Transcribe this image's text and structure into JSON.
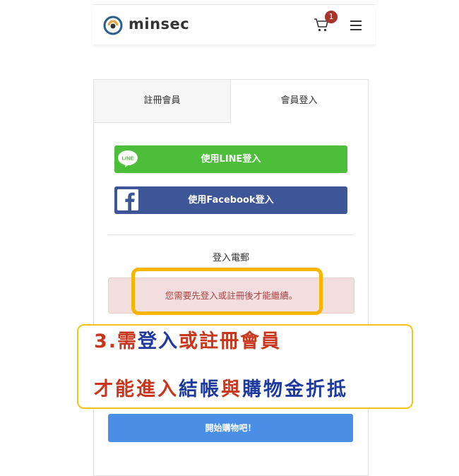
{
  "header": {
    "brand": "minsec",
    "cart_count": "1"
  },
  "tabs": [
    {
      "label": "註冊會員"
    },
    {
      "label": "會員登入"
    }
  ],
  "login": {
    "line_button": "使用LINE登入",
    "line_icon_text": "LINE",
    "facebook_button": "使用Facebook登入",
    "email_label": "登入電郵",
    "alert_text": "您需要先登入或註冊後才能繼續。",
    "shop_button": "開始購物吧！"
  },
  "annotation": {
    "line1": [
      {
        "text": "3.需",
        "color": "red"
      },
      {
        "text": "登入",
        "color": "blue"
      },
      {
        "text": "或",
        "color": "red"
      },
      {
        "text": "註冊會員",
        "color": "red"
      }
    ],
    "line2": [
      {
        "text": "才能進入",
        "color": "red"
      },
      {
        "text": "結帳",
        "color": "blue"
      },
      {
        "text": "與",
        "color": "red"
      },
      {
        "text": "購物金折抵",
        "color": "blue"
      }
    ]
  },
  "colors": {
    "line_green": "#4cbe39",
    "facebook_blue": "#3d5697",
    "alert_bg": "#f2dede",
    "alert_text": "#a94442",
    "highlight_yellow": "#f7b500",
    "shop_button_blue": "#4a8ee6",
    "badge_red": "#a8322c"
  },
  "icons": [
    "minsec-logo-icon",
    "cart-icon",
    "hamburger-menu-icon",
    "line-icon",
    "facebook-icon"
  ]
}
